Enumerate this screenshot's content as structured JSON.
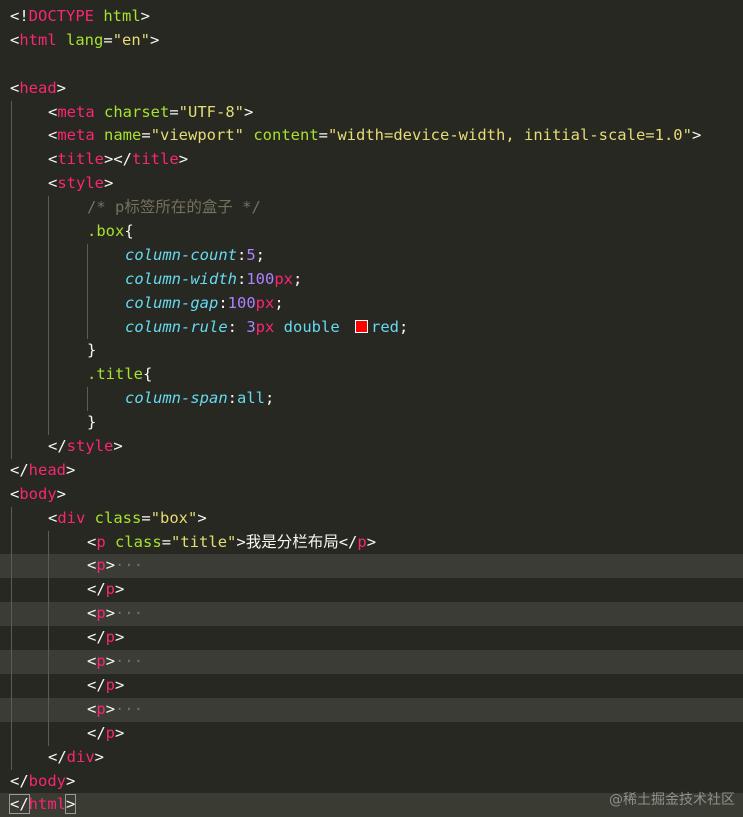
{
  "editor": {
    "lines": {
      "l1_a": "<!",
      "l1_b": "DOCTYPE",
      "l1_c": " html",
      "l1_d": ">",
      "l2_a": "<",
      "l2_b": "html",
      "l2_c": " lang",
      "l2_d": "=",
      "l2_e": "\"en\"",
      "l2_f": ">",
      "l4_a": "<",
      "l4_b": "head",
      "l4_c": ">",
      "l5_a": "<",
      "l5_b": "meta",
      "l5_c": " charset",
      "l5_d": "=",
      "l5_e": "\"UTF-8\"",
      "l5_f": ">",
      "l6_a": "<",
      "l6_b": "meta",
      "l6_c": " name",
      "l6_d": "=",
      "l6_e": "\"viewport\"",
      "l6_f": " content",
      "l6_g": "=",
      "l6_h": "\"width=device-width, initial-scale=1.0\"",
      "l6_i": ">",
      "l7_a": "<",
      "l7_b": "title",
      "l7_c": "></",
      "l7_d": "title",
      "l7_e": ">",
      "l8_a": "<",
      "l8_b": "style",
      "l8_c": ">",
      "l9": "/* p标签所在的盒子 */",
      "l10_a": ".box",
      "l10_b": "{",
      "l11_a": "column-count",
      "l11_b": ":",
      "l11_c": "5",
      "l11_d": ";",
      "l12_a": "column-width",
      "l12_b": ":",
      "l12_c": "100",
      "l12_d": "px",
      "l12_e": ";",
      "l13_a": "column-gap",
      "l13_b": ":",
      "l13_c": "100",
      "l13_d": "px",
      "l13_e": ";",
      "l14_a": "column-rule",
      "l14_b": ": ",
      "l14_c": "3",
      "l14_d": "px",
      "l14_e": " double ",
      "l14_f": "red",
      "l14_g": ";",
      "l15": "}",
      "l16_a": ".title",
      "l16_b": "{",
      "l17_a": "column-span",
      "l17_b": ":",
      "l17_c": "all",
      "l17_d": ";",
      "l18": "}",
      "l19_a": "</",
      "l19_b": "style",
      "l19_c": ">",
      "l20_a": "</",
      "l20_b": "head",
      "l20_c": ">",
      "l21_a": "<",
      "l21_b": "body",
      "l21_c": ">",
      "l22_a": "<",
      "l22_b": "div",
      "l22_c": " class",
      "l22_d": "=",
      "l22_e": "\"box\"",
      "l22_f": ">",
      "l23_a": "<",
      "l23_b": "p",
      "l23_c": " class",
      "l23_d": "=",
      "l23_e": "\"title\"",
      "l23_f": ">",
      "l23_g": "我是分栏布局",
      "l23_h": "</",
      "l23_i": "p",
      "l23_j": ">",
      "p_open_a": "<",
      "p_open_b": "p",
      "p_open_c": ">",
      "p_fold": "···",
      "p_close_a": "</",
      "p_close_b": "p",
      "p_close_c": ">",
      "l32_a": "</",
      "l32_b": "div",
      "l32_c": ">",
      "l33_a": "</",
      "l33_b": "body",
      "l33_c": ">",
      "l34_a": "</",
      "l34_b": "html",
      "l34_c": ">"
    },
    "swatch_color": "#ff0000"
  },
  "watermark": "@稀土掘金技术社区"
}
